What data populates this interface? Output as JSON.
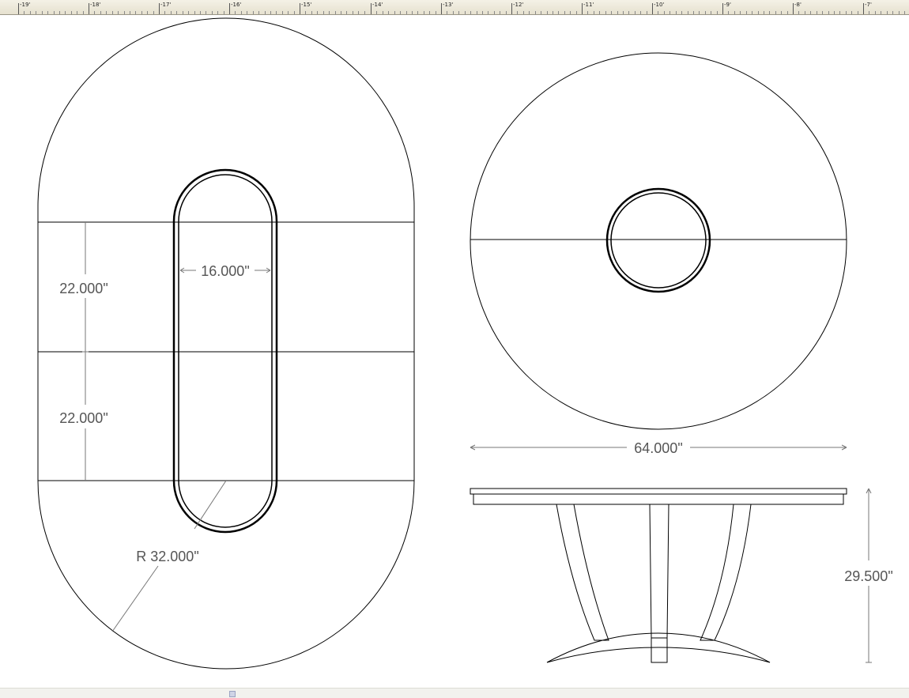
{
  "ruler": {
    "labels": [
      "-19'",
      "-18'",
      "-17'",
      "-16'",
      "-15'",
      "-14'",
      "-13'",
      "-12'",
      "-11'",
      "-10'",
      "-9'",
      "-8'",
      "-7'"
    ]
  },
  "dimensions": {
    "top_section_height": "22.000\"",
    "bottom_section_height": "22.000\"",
    "opening_width": "16.000\"",
    "end_radius": "R 32.000\"",
    "round_diameter": "64.000\"",
    "table_height": "29.500\""
  },
  "colors": {
    "line": "#000000",
    "dimension_line": "#666666",
    "ruler_bg": "#ece8d8"
  }
}
